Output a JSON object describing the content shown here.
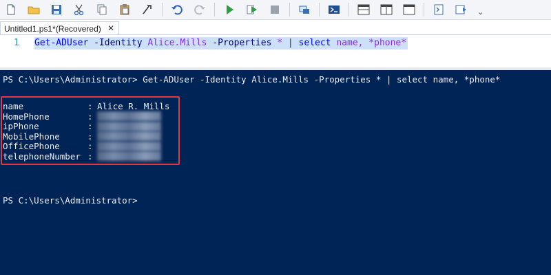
{
  "toolbar": {
    "icons": [
      "new-file-icon",
      "open-folder-icon",
      "save-icon",
      "cut-icon",
      "copy-icon",
      "paste-icon",
      "clear-icon",
      "undo-icon",
      "redo-icon",
      "run-script-icon",
      "run-selection-icon",
      "stop-icon",
      "new-remote-tab-icon",
      "start-powershell-icon",
      "show-script-pane-top-icon",
      "show-script-pane-right-icon",
      "show-script-pane-max-icon",
      "show-command-window-icon",
      "show-command-addon-icon"
    ],
    "more": "⌄"
  },
  "tab": {
    "title": "Untitled1.ps1*(Recovered)",
    "close": "✕"
  },
  "editor": {
    "line_number": "1",
    "tokens": {
      "cmd": "Get-ADUser",
      "param1": "-Identity",
      "arg1": "Alice.Mills",
      "param2": "-Properties",
      "arg2": "*",
      "pipe": "|",
      "select": "select",
      "fields": "name, *phone*"
    }
  },
  "console": {
    "prompt_command": "PS C:\\Users\\Administrator> Get-ADUser -Identity Alice.Mills -Properties * | select name, *phone*",
    "rows": [
      {
        "name": "name",
        "sep": ":",
        "value": "Alice R. Mills"
      },
      {
        "name": "HomePhone",
        "sep": ":",
        "value": ""
      },
      {
        "name": "ipPhone",
        "sep": ":",
        "value": ""
      },
      {
        "name": "MobilePhone",
        "sep": ":",
        "value": ""
      },
      {
        "name": "OfficePhone",
        "sep": ":",
        "value": ""
      },
      {
        "name": "telephoneNumber",
        "sep": ":",
        "value": ""
      }
    ],
    "final_prompt": "PS C:\\Users\\Administrator>"
  },
  "colors": {
    "console_bg": "#012456",
    "console_fg": "#eeedf0",
    "highlight": "#e0393e",
    "selection": "#cce0f7"
  }
}
